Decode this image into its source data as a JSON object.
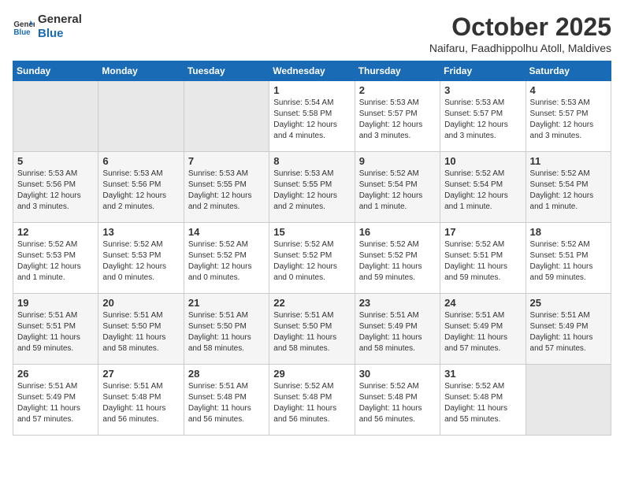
{
  "header": {
    "logo_line1": "General",
    "logo_line2": "Blue",
    "title": "October 2025",
    "subtitle": "Naifaru, Faadhippolhu Atoll, Maldives"
  },
  "weekdays": [
    "Sunday",
    "Monday",
    "Tuesday",
    "Wednesday",
    "Thursday",
    "Friday",
    "Saturday"
  ],
  "weeks": [
    [
      {
        "day": "",
        "info": ""
      },
      {
        "day": "",
        "info": ""
      },
      {
        "day": "",
        "info": ""
      },
      {
        "day": "1",
        "info": "Sunrise: 5:54 AM\nSunset: 5:58 PM\nDaylight: 12 hours\nand 4 minutes."
      },
      {
        "day": "2",
        "info": "Sunrise: 5:53 AM\nSunset: 5:57 PM\nDaylight: 12 hours\nand 3 minutes."
      },
      {
        "day": "3",
        "info": "Sunrise: 5:53 AM\nSunset: 5:57 PM\nDaylight: 12 hours\nand 3 minutes."
      },
      {
        "day": "4",
        "info": "Sunrise: 5:53 AM\nSunset: 5:57 PM\nDaylight: 12 hours\nand 3 minutes."
      }
    ],
    [
      {
        "day": "5",
        "info": "Sunrise: 5:53 AM\nSunset: 5:56 PM\nDaylight: 12 hours\nand 3 minutes."
      },
      {
        "day": "6",
        "info": "Sunrise: 5:53 AM\nSunset: 5:56 PM\nDaylight: 12 hours\nand 2 minutes."
      },
      {
        "day": "7",
        "info": "Sunrise: 5:53 AM\nSunset: 5:55 PM\nDaylight: 12 hours\nand 2 minutes."
      },
      {
        "day": "8",
        "info": "Sunrise: 5:53 AM\nSunset: 5:55 PM\nDaylight: 12 hours\nand 2 minutes."
      },
      {
        "day": "9",
        "info": "Sunrise: 5:52 AM\nSunset: 5:54 PM\nDaylight: 12 hours\nand 1 minute."
      },
      {
        "day": "10",
        "info": "Sunrise: 5:52 AM\nSunset: 5:54 PM\nDaylight: 12 hours\nand 1 minute."
      },
      {
        "day": "11",
        "info": "Sunrise: 5:52 AM\nSunset: 5:54 PM\nDaylight: 12 hours\nand 1 minute."
      }
    ],
    [
      {
        "day": "12",
        "info": "Sunrise: 5:52 AM\nSunset: 5:53 PM\nDaylight: 12 hours\nand 1 minute."
      },
      {
        "day": "13",
        "info": "Sunrise: 5:52 AM\nSunset: 5:53 PM\nDaylight: 12 hours\nand 0 minutes."
      },
      {
        "day": "14",
        "info": "Sunrise: 5:52 AM\nSunset: 5:52 PM\nDaylight: 12 hours\nand 0 minutes."
      },
      {
        "day": "15",
        "info": "Sunrise: 5:52 AM\nSunset: 5:52 PM\nDaylight: 12 hours\nand 0 minutes."
      },
      {
        "day": "16",
        "info": "Sunrise: 5:52 AM\nSunset: 5:52 PM\nDaylight: 11 hours\nand 59 minutes."
      },
      {
        "day": "17",
        "info": "Sunrise: 5:52 AM\nSunset: 5:51 PM\nDaylight: 11 hours\nand 59 minutes."
      },
      {
        "day": "18",
        "info": "Sunrise: 5:52 AM\nSunset: 5:51 PM\nDaylight: 11 hours\nand 59 minutes."
      }
    ],
    [
      {
        "day": "19",
        "info": "Sunrise: 5:51 AM\nSunset: 5:51 PM\nDaylight: 11 hours\nand 59 minutes."
      },
      {
        "day": "20",
        "info": "Sunrise: 5:51 AM\nSunset: 5:50 PM\nDaylight: 11 hours\nand 58 minutes."
      },
      {
        "day": "21",
        "info": "Sunrise: 5:51 AM\nSunset: 5:50 PM\nDaylight: 11 hours\nand 58 minutes."
      },
      {
        "day": "22",
        "info": "Sunrise: 5:51 AM\nSunset: 5:50 PM\nDaylight: 11 hours\nand 58 minutes."
      },
      {
        "day": "23",
        "info": "Sunrise: 5:51 AM\nSunset: 5:49 PM\nDaylight: 11 hours\nand 58 minutes."
      },
      {
        "day": "24",
        "info": "Sunrise: 5:51 AM\nSunset: 5:49 PM\nDaylight: 11 hours\nand 57 minutes."
      },
      {
        "day": "25",
        "info": "Sunrise: 5:51 AM\nSunset: 5:49 PM\nDaylight: 11 hours\nand 57 minutes."
      }
    ],
    [
      {
        "day": "26",
        "info": "Sunrise: 5:51 AM\nSunset: 5:49 PM\nDaylight: 11 hours\nand 57 minutes."
      },
      {
        "day": "27",
        "info": "Sunrise: 5:51 AM\nSunset: 5:48 PM\nDaylight: 11 hours\nand 56 minutes."
      },
      {
        "day": "28",
        "info": "Sunrise: 5:51 AM\nSunset: 5:48 PM\nDaylight: 11 hours\nand 56 minutes."
      },
      {
        "day": "29",
        "info": "Sunrise: 5:52 AM\nSunset: 5:48 PM\nDaylight: 11 hours\nand 56 minutes."
      },
      {
        "day": "30",
        "info": "Sunrise: 5:52 AM\nSunset: 5:48 PM\nDaylight: 11 hours\nand 56 minutes."
      },
      {
        "day": "31",
        "info": "Sunrise: 5:52 AM\nSunset: 5:48 PM\nDaylight: 11 hours\nand 55 minutes."
      },
      {
        "day": "",
        "info": ""
      }
    ]
  ]
}
